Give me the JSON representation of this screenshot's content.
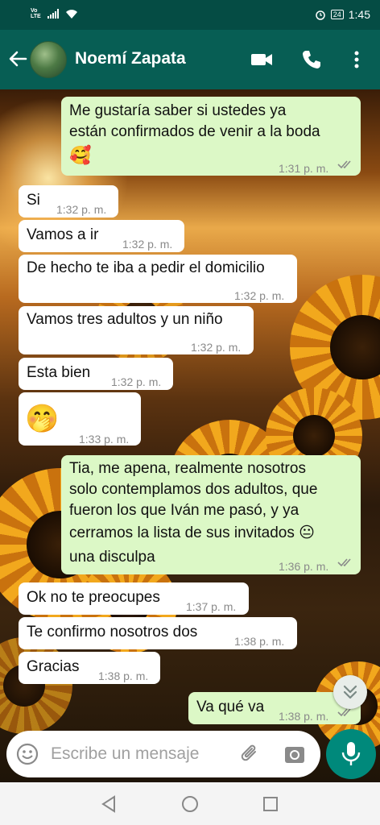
{
  "status_bar": {
    "carrier_top": "Vo",
    "carrier_bottom": "LTE",
    "battery": "24",
    "time": "1:45"
  },
  "header": {
    "contact_name": "Noemí Zapata",
    "icons": [
      "back-arrow-icon",
      "video-call-icon",
      "phone-icon",
      "more-vertical-icon"
    ]
  },
  "messages": [
    {
      "dir": "out",
      "lines": [
        "Me gustaría saber si ustedes ya",
        "están confirmados de venir a la boda",
        "🥰"
      ],
      "time": "1:31 p. m."
    },
    {
      "dir": "in",
      "lines": [
        "Si"
      ],
      "time": "1:32 p. m."
    },
    {
      "dir": "in",
      "lines": [
        "Vamos a ir"
      ],
      "time": "1:32 p. m."
    },
    {
      "dir": "in",
      "lines": [
        "De hecho te iba a pedir el domicilio"
      ],
      "time": "1:32 p. m."
    },
    {
      "dir": "in",
      "lines": [
        "Vamos tres adultos y un niño"
      ],
      "time": "1:32 p. m."
    },
    {
      "dir": "in",
      "lines": [
        "Esta bien"
      ],
      "time": "1:32 p. m."
    },
    {
      "dir": "in",
      "lines": [
        "🤭"
      ],
      "time": "1:33 p. m."
    },
    {
      "dir": "out",
      "lines": [
        "Tia, me apena, realmente nosotros",
        "solo contemplamos dos adultos, que",
        "fueron los que Iván me pasó, y ya",
        "cerramos la lista de sus invitados 😐",
        "una disculpa"
      ],
      "time": "1:36 p. m."
    },
    {
      "dir": "in",
      "lines": [
        "Ok no te preocupes"
      ],
      "time": "1:37 p. m."
    },
    {
      "dir": "in",
      "lines": [
        "Te confirmo nosotros dos"
      ],
      "time": "1:38 p. m."
    },
    {
      "dir": "in",
      "lines": [
        "Gracias"
      ],
      "time": "1:38 p. m."
    },
    {
      "dir": "out",
      "lines": [
        "Va qué va"
      ],
      "time": "1:38 p. m."
    }
  ],
  "input": {
    "placeholder": "Escribe un mensaje"
  },
  "colors": {
    "header": "#075e54",
    "status_bar": "#054c44",
    "outgoing_bubble": "#dcf8c6",
    "incoming_bubble": "#ffffff",
    "mic_button": "#00897b",
    "read_ticks": "#8a8a8a"
  }
}
